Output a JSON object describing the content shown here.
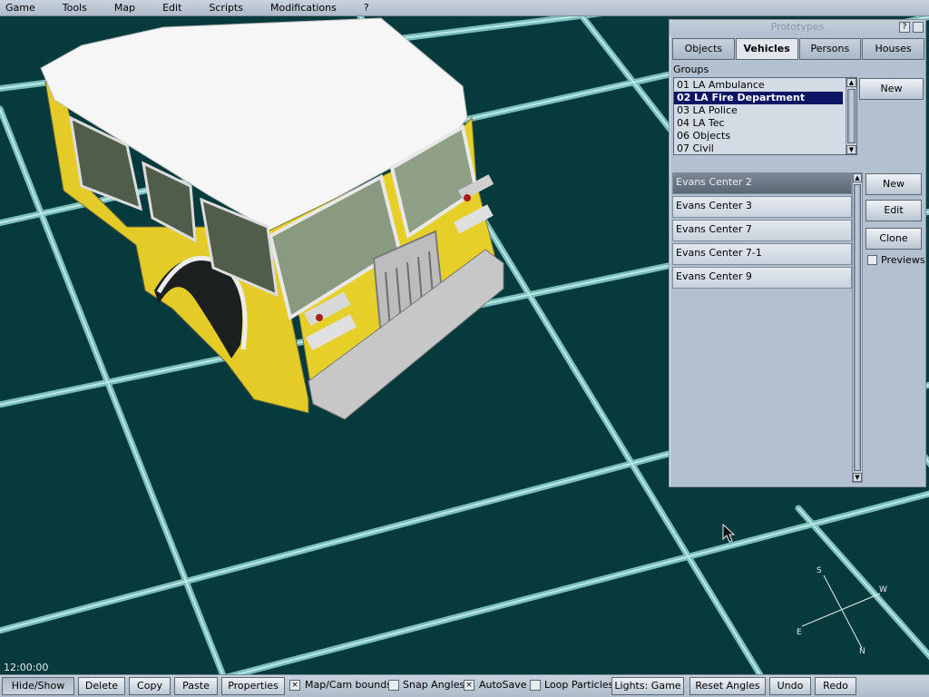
{
  "menu": [
    "Game",
    "Tools",
    "Map",
    "Edit",
    "Scripts",
    "Modifications",
    "?"
  ],
  "prototypes_panel": {
    "title": "Prototypes",
    "help_button": "?",
    "tabs": [
      {
        "label": "Objects",
        "active": false
      },
      {
        "label": "Vehicles",
        "active": true
      },
      {
        "label": "Persons",
        "active": false
      },
      {
        "label": "Houses",
        "active": false
      }
    ],
    "groups_label": "Groups",
    "groups": [
      {
        "label": "01 LA Ambulance",
        "selected": false
      },
      {
        "label": "02 LA Fire Department",
        "selected": true
      },
      {
        "label": "03 LA Police",
        "selected": false
      },
      {
        "label": "04 LA Tec",
        "selected": false
      },
      {
        "label": "06 Objects",
        "selected": false
      },
      {
        "label": "07 Civil",
        "selected": false
      }
    ],
    "groups_new_button": "New",
    "vehicles": [
      {
        "label": "Evans Center 2",
        "selected": true
      },
      {
        "label": "Evans Center 3",
        "selected": false
      },
      {
        "label": "Evans Center 7",
        "selected": false
      },
      {
        "label": "Evans Center 7-1",
        "selected": false
      },
      {
        "label": "Evans Center 9",
        "selected": false
      }
    ],
    "vehicle_buttons": {
      "new": "New",
      "edit": "Edit",
      "clone": "Clone"
    },
    "previews_label": "Previews",
    "previews_checked": false
  },
  "compass": {
    "s": "S",
    "w": "W",
    "e": "E",
    "n": "N"
  },
  "clock": "12:00:00",
  "toolbar": {
    "hide_show": "Hide/Show",
    "delete": "Delete",
    "copy": "Copy",
    "paste": "Paste",
    "properties": "Properties",
    "map_cam_bounds": "Map/Cam bounds",
    "map_cam_bounds_checked": true,
    "snap_angles": "Snap Angles",
    "snap_angles_checked": false,
    "autosave": "AutoSave",
    "autosave_checked": true,
    "loop_particles": "Loop Particles",
    "loop_particles_checked": false,
    "lights": "Lights: Game",
    "reset_angles": "Reset Angles",
    "undo": "Undo",
    "redo": "Redo",
    "check_mark": "×"
  },
  "colors": {
    "ground": "#063a3d",
    "grid_line": "#8fd6d4",
    "selection": "#0c1464",
    "truck_yellow": "#e9d12a",
    "truck_roof": "#f7f7f7"
  }
}
